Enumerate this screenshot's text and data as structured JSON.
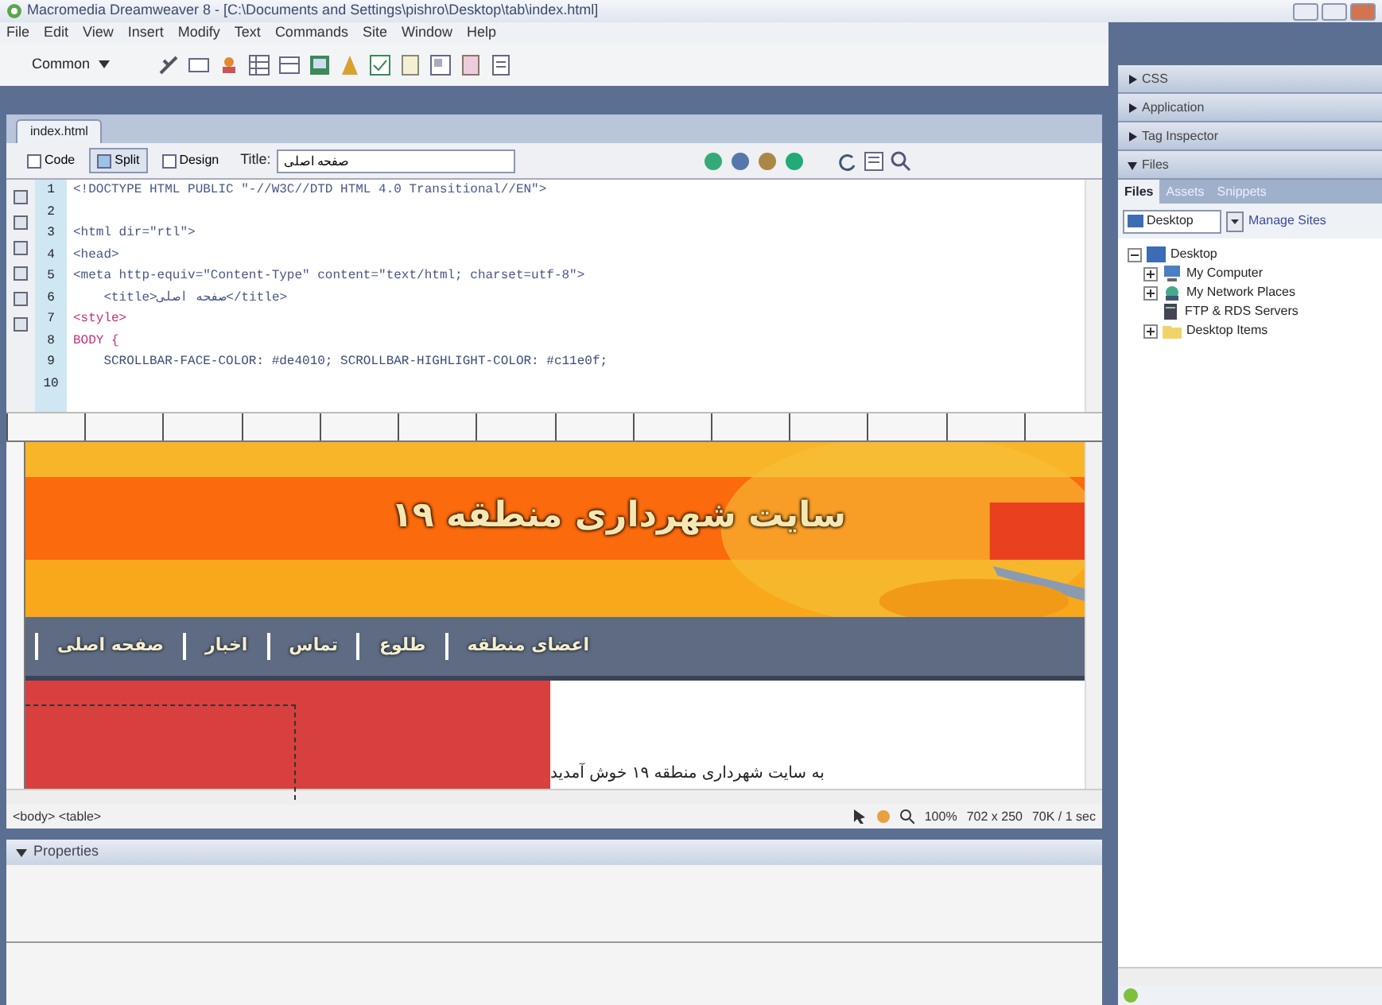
{
  "window": {
    "title": "Macromedia Dreamweaver 8 - [C:\\Documents and Settings\\pishro\\Desktop\\tab\\index.html]"
  },
  "menu": [
    "File",
    "Edit",
    "View",
    "Insert",
    "Modify",
    "Text",
    "Commands",
    "Site",
    "Window",
    "Help"
  ],
  "insert_bar": {
    "category": "Common"
  },
  "document": {
    "tab": "index.html",
    "view_buttons": [
      {
        "label": "Code",
        "selected": false
      },
      {
        "label": "Split",
        "selected": true
      },
      {
        "label": "Design",
        "selected": false
      }
    ],
    "title_label": "Title:",
    "title_value": "صفحه اصلی"
  },
  "code": {
    "lines": [
      {
        "number": "1",
        "kind": "markup",
        "text": "<!DOCTYPE HTML PUBLIC \"-//W3C//DTD HTML 4.0 Transitional//EN\">"
      },
      {
        "number": "2",
        "kind": "blank"
      },
      {
        "number": "3",
        "kind": "markup",
        "text": "<html dir=\"rtl\">"
      },
      {
        "number": "4",
        "kind": "markup",
        "text": "<head>"
      },
      {
        "number": "5",
        "kind": "markup",
        "text": "<meta http-equiv=\"Content-Type\" content=\"text/html; charset=utf-8\">"
      },
      {
        "number": "6",
        "kind": "markup",
        "text": "    <title>صفحه اصلی</title>"
      },
      {
        "number": "7",
        "kind": "css",
        "text": "<style>"
      },
      {
        "number": "8",
        "kind": "css",
        "text": "BODY {"
      },
      {
        "number": "9",
        "kind": "property",
        "text": "    SCROLLBAR-FACE-COLOR: #de4010; SCROLLBAR-HIGHLIGHT-COLOR: #c11e0f;"
      },
      {
        "number": "10",
        "kind": "blank"
      }
    ]
  },
  "design": {
    "banner_title": "سایت شهرداری منطقه ۱۹",
    "nav": [
      "اعضای منطقه",
      "طلوع",
      "تماس",
      "اخبار",
      "صفحه اصلی"
    ],
    "welcome": "به سایت شهرداری منطقه ۱۹ خوش آمدید"
  },
  "status_bar": {
    "tags": "<body> <table>",
    "zoom": "100%",
    "size": "702 x 250",
    "download": "70K / 1 sec"
  },
  "properties": {
    "title": "Properties"
  },
  "panels": [
    {
      "label": "CSS",
      "expanded": false
    },
    {
      "label": "Application",
      "expanded": false
    },
    {
      "label": "Tag Inspector",
      "expanded": false
    },
    {
      "label": "Files",
      "expanded": true
    }
  ],
  "files": {
    "tabs": [
      {
        "label": "Files",
        "selected": true
      },
      {
        "label": "Assets",
        "selected": false
      },
      {
        "label": "Snippets",
        "selected": false
      }
    ],
    "location": "Desktop",
    "manage": "Manage Sites",
    "tree": [
      {
        "label": "Desktop",
        "kind": "desktop",
        "expanded": true,
        "children": [
          {
            "label": "My Computer",
            "kind": "computer"
          },
          {
            "label": "My Network Places",
            "kind": "network"
          },
          {
            "label": "FTP & RDS Servers",
            "kind": "server"
          },
          {
            "label": "Desktop Items",
            "kind": "folder"
          }
        ]
      }
    ]
  }
}
